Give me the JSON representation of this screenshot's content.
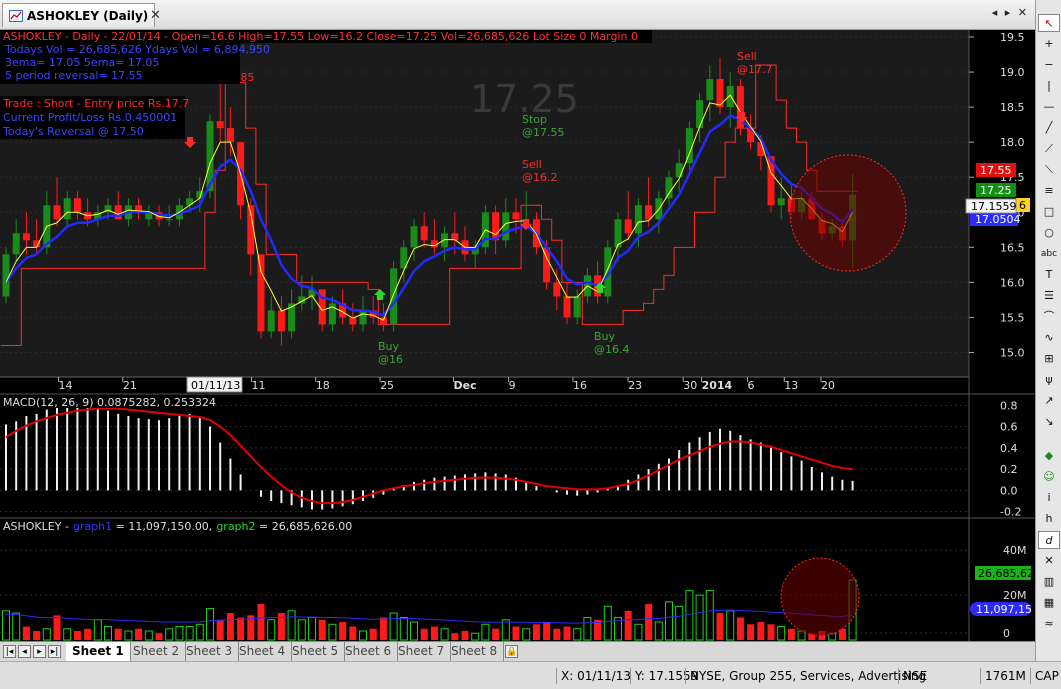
{
  "window": {
    "tab_title": "ASHOKLEY (Daily)"
  },
  "price_pane": {
    "header_line": "ASHOKLEY - Daily - 22/01/14 - Open=16.6  High=17.55  Low=16.2  Close=17.25  Vol=26,685,626   Lot Size 0  Margin  0",
    "info_lines": [
      "Todays Vol = 26,685,626 Ydays Vol = 6,894,950",
      "3ema= 17.05    5ema= 17.05",
      "5 period reversal=  17.55"
    ],
    "trade_lines": [
      "Trade : Short - Entry price Rs.17.7",
      "Current Profit/Loss Rs.0.450001",
      "Today's Reversal @ 17.50"
    ],
    "watermark": "17.25",
    "y_ticks": [
      "19.5",
      "19.0",
      "18.5",
      "18.0",
      "17.5",
      "17.0",
      "16.5",
      "16.0",
      "15.5",
      "15.0"
    ],
    "x_ticks": [
      "14",
      "21",
      "28",
      "11",
      "18",
      "25",
      "Dec",
      "9",
      "16",
      "23",
      "30",
      "2014",
      "6",
      "13",
      "20"
    ],
    "date_box": "01/11/13",
    "markers": [
      {
        "type": "sell",
        "label": "Sell",
        "price": "@18.85"
      },
      {
        "type": "buy",
        "label": "Buy",
        "price": "@16"
      },
      {
        "type": "stop",
        "label": "Stop",
        "price": "@17.55"
      },
      {
        "type": "sell",
        "label": "Sell",
        "price": "@16.2"
      },
      {
        "type": "buy",
        "label": "Buy",
        "price": "@16.4"
      },
      {
        "type": "sell",
        "label": "Sell",
        "price": "@17.7"
      }
    ],
    "axis_tags": {
      "high": "17.55",
      "close": "17.25",
      "cursor": "17.1559",
      "ema": "17.0504",
      "partial": "6"
    },
    "colors": {
      "up": "#1a8c1a",
      "down": "#ff1a1a",
      "ema_yellow": "#ffff33",
      "ema_blue": "#1f2bff",
      "stop_line": "#ff2a2a"
    }
  },
  "macd_pane": {
    "header": "MACD(12, 26, 9) 0.0875282, 0.253324",
    "y_ticks": [
      "0.8",
      "0.6",
      "0.4",
      "0.2",
      "0.0",
      "-0.2"
    ]
  },
  "volume_pane": {
    "symbol": "ASHOKLEY -",
    "graph1_label": "graph1",
    "graph1_value": " = 11,097,150.00,",
    "graph2_label": "graph2",
    "graph2_value": " = 26,685,626.00",
    "y_ticks": [
      "40M",
      "20M",
      "0"
    ],
    "tags": {
      "vol": "26,685,62",
      "avg": "11,097,15"
    }
  },
  "chart_data": [
    {
      "type": "candlestick",
      "title": "ASHOKLEY - Daily",
      "x_labels": [
        "14",
        "21",
        "28",
        "11",
        "18",
        "25",
        "Dec",
        "9",
        "16",
        "23",
        "30",
        "2014",
        "6",
        "13",
        "20"
      ],
      "ylim": [
        14.65,
        19.6
      ],
      "candles": [
        [
          15.8,
          16.5,
          15.7,
          16.4
        ],
        [
          16.4,
          16.9,
          16.3,
          16.7
        ],
        [
          16.7,
          17.0,
          16.4,
          16.6
        ],
        [
          16.6,
          16.9,
          16.4,
          16.5
        ],
        [
          16.5,
          17.3,
          16.4,
          17.1
        ],
        [
          17.1,
          17.5,
          16.8,
          16.9
        ],
        [
          16.9,
          17.3,
          16.8,
          17.2
        ],
        [
          17.2,
          17.3,
          16.9,
          17.0
        ],
        [
          17.0,
          17.2,
          16.8,
          16.9
        ],
        [
          16.9,
          17.1,
          16.8,
          17.0
        ],
        [
          17.0,
          17.2,
          16.9,
          17.1
        ],
        [
          17.1,
          17.3,
          16.9,
          16.9
        ],
        [
          16.9,
          17.2,
          16.8,
          17.1
        ],
        [
          17.1,
          17.2,
          16.9,
          17.0
        ],
        [
          16.9,
          17.1,
          16.8,
          17.0
        ],
        [
          17.0,
          17.1,
          16.8,
          16.9
        ],
        [
          16.9,
          17.1,
          16.8,
          16.9
        ],
        [
          16.9,
          17.2,
          16.8,
          17.1
        ],
        [
          17.1,
          17.3,
          17.0,
          17.2
        ],
        [
          17.2,
          17.5,
          17.0,
          17.3
        ],
        [
          17.3,
          18.4,
          17.2,
          18.3
        ],
        [
          18.3,
          18.9,
          18.0,
          18.2
        ],
        [
          18.2,
          18.5,
          17.8,
          18.0
        ],
        [
          18.0,
          18.0,
          16.9,
          17.1
        ],
        [
          17.1,
          17.2,
          16.1,
          16.4
        ],
        [
          16.4,
          16.4,
          15.2,
          15.3
        ],
        [
          15.3,
          15.8,
          15.2,
          15.6
        ],
        [
          15.6,
          15.8,
          15.1,
          15.3
        ],
        [
          15.3,
          15.9,
          15.2,
          15.7
        ],
        [
          15.7,
          16.1,
          15.6,
          15.8
        ],
        [
          15.8,
          16.1,
          15.6,
          15.9
        ],
        [
          15.9,
          15.9,
          15.3,
          15.4
        ],
        [
          15.4,
          15.8,
          15.3,
          15.7
        ],
        [
          15.7,
          15.9,
          15.4,
          15.5
        ],
        [
          15.5,
          15.7,
          15.3,
          15.4
        ],
        [
          15.4,
          15.8,
          15.3,
          15.6
        ],
        [
          15.6,
          15.8,
          15.4,
          15.5
        ],
        [
          15.5,
          15.7,
          15.3,
          15.4
        ],
        [
          15.4,
          16.3,
          15.3,
          16.2
        ],
        [
          16.2,
          16.6,
          16.0,
          16.5
        ],
        [
          16.5,
          16.9,
          16.3,
          16.8
        ],
        [
          16.8,
          17.0,
          16.5,
          16.6
        ],
        [
          16.6,
          16.9,
          16.4,
          16.5
        ],
        [
          16.5,
          16.8,
          16.3,
          16.7
        ],
        [
          16.7,
          17.0,
          16.4,
          16.6
        ],
        [
          16.6,
          16.8,
          16.3,
          16.4
        ],
        [
          16.4,
          16.6,
          16.2,
          16.5
        ],
        [
          16.5,
          17.1,
          16.4,
          17.0
        ],
        [
          17.0,
          17.1,
          16.4,
          16.6
        ],
        [
          16.6,
          17.2,
          16.5,
          17.0
        ],
        [
          17.0,
          17.2,
          16.7,
          16.9
        ],
        [
          16.9,
          17.3,
          16.8,
          16.9
        ],
        [
          16.9,
          17.0,
          16.4,
          16.5
        ],
        [
          16.5,
          16.6,
          15.9,
          16.0
        ],
        [
          16.0,
          16.2,
          15.6,
          15.8
        ],
        [
          15.8,
          16.0,
          15.4,
          15.5
        ],
        [
          15.5,
          15.9,
          15.4,
          15.8
        ],
        [
          15.8,
          16.2,
          15.7,
          16.1
        ],
        [
          16.1,
          16.3,
          15.7,
          15.8
        ],
        [
          15.8,
          16.6,
          15.7,
          16.5
        ],
        [
          16.5,
          17.0,
          16.3,
          16.9
        ],
        [
          16.9,
          17.3,
          16.6,
          16.7
        ],
        [
          16.7,
          17.2,
          16.5,
          17.1
        ],
        [
          17.1,
          17.5,
          16.8,
          16.9
        ],
        [
          16.9,
          17.3,
          16.7,
          17.2
        ],
        [
          17.2,
          17.6,
          17.1,
          17.5
        ],
        [
          17.5,
          17.9,
          17.3,
          17.7
        ],
        [
          17.7,
          18.3,
          17.6,
          18.2
        ],
        [
          18.2,
          18.7,
          18.0,
          18.6
        ],
        [
          18.6,
          19.1,
          18.3,
          18.9
        ],
        [
          18.9,
          19.2,
          18.4,
          18.5
        ],
        [
          18.5,
          19.0,
          18.2,
          18.8
        ],
        [
          18.8,
          18.9,
          18.1,
          18.2
        ],
        [
          18.2,
          18.4,
          17.9,
          18.0
        ],
        [
          18.0,
          18.1,
          17.6,
          17.8
        ],
        [
          17.8,
          17.8,
          17.0,
          17.1
        ],
        [
          17.1,
          17.5,
          16.9,
          17.2
        ],
        [
          17.2,
          17.4,
          16.9,
          17.0
        ],
        [
          17.0,
          17.3,
          16.9,
          17.2
        ],
        [
          17.2,
          17.3,
          16.9,
          16.9
        ],
        [
          16.9,
          17.0,
          16.6,
          16.7
        ],
        [
          16.7,
          16.9,
          16.6,
          16.8
        ],
        [
          16.8,
          16.9,
          16.5,
          16.6
        ],
        [
          16.6,
          17.55,
          16.2,
          17.25
        ]
      ],
      "ema_yellow": [
        16.0,
        16.3,
        16.5,
        16.5,
        16.8,
        16.85,
        17.0,
        17.0,
        16.95,
        16.97,
        17.03,
        16.97,
        17.03,
        17.02,
        17.01,
        16.94,
        16.92,
        17.0,
        17.1,
        17.2,
        17.7,
        18.0,
        18.0,
        17.55,
        16.98,
        16.15,
        15.88,
        15.59,
        15.65,
        15.73,
        15.81,
        15.6,
        15.65,
        15.58,
        15.49,
        15.55,
        15.53,
        15.46,
        15.83,
        16.17,
        16.48,
        16.54,
        16.52,
        16.61,
        16.61,
        16.5,
        16.5,
        16.75,
        16.68,
        16.84,
        16.87,
        16.88,
        16.69,
        16.35,
        16.07,
        15.79,
        15.79,
        15.95,
        15.87,
        16.19,
        16.54,
        16.62,
        16.86,
        16.88,
        17.04,
        17.27,
        17.48,
        17.84,
        18.22,
        18.56,
        18.53,
        18.67,
        18.43,
        18.22,
        18.01,
        17.56,
        17.38,
        17.19,
        17.2,
        17.05,
        16.88,
        16.84,
        16.72,
        17.0
      ],
      "ema_blue": [
        16.0,
        16.2,
        16.35,
        16.4,
        16.55,
        16.65,
        16.8,
        16.85,
        16.85,
        16.9,
        16.95,
        16.95,
        17.0,
        17.0,
        17.0,
        16.97,
        16.95,
        16.98,
        17.03,
        17.1,
        17.4,
        17.65,
        17.75,
        17.6,
        17.3,
        16.9,
        16.6,
        16.25,
        16.05,
        15.95,
        15.92,
        15.78,
        15.75,
        15.68,
        15.6,
        15.6,
        15.58,
        15.53,
        15.7,
        15.92,
        16.16,
        16.3,
        16.37,
        16.45,
        16.5,
        16.47,
        16.47,
        16.62,
        16.62,
        16.72,
        16.77,
        16.8,
        16.7,
        16.5,
        16.3,
        16.05,
        15.97,
        16.0,
        15.95,
        16.1,
        16.35,
        16.45,
        16.65,
        16.72,
        16.85,
        17.05,
        17.25,
        17.55,
        17.85,
        18.15,
        18.25,
        18.38,
        18.32,
        18.2,
        18.05,
        17.75,
        17.55,
        17.4,
        17.35,
        17.2,
        17.05,
        16.98,
        16.85,
        17.05
      ],
      "stop_line": [
        15.1,
        15.1,
        16.2,
        16.2,
        16.2,
        16.2,
        16.2,
        16.2,
        16.2,
        16.2,
        16.2,
        16.2,
        16.2,
        16.2,
        16.2,
        16.2,
        16.2,
        16.2,
        16.2,
        16.2,
        17.0,
        17.6,
        18.85,
        18.85,
        18.2,
        17.4,
        16.4,
        16.4,
        16.4,
        16.0,
        16.0,
        16.0,
        16.0,
        16.0,
        16.0,
        16.0,
        15.9,
        15.4,
        15.4,
        15.4,
        15.4,
        15.4,
        15.4,
        15.4,
        16.2,
        16.2,
        16.2,
        16.2,
        16.2,
        16.2,
        16.2,
        17.1,
        17.1,
        16.9,
        16.6,
        16.0,
        16.0,
        15.4,
        15.4,
        15.4,
        15.4,
        15.6,
        15.6,
        15.7,
        15.9,
        16.1,
        16.5,
        16.5,
        17.0,
        17.0,
        17.5,
        18.0,
        18.2,
        18.2,
        19.1,
        19.1,
        18.6,
        18.2,
        18.0,
        17.6,
        17.3,
        17.3,
        17.3,
        17.3
      ]
    },
    {
      "type": "bar",
      "title": "MACD(12, 26, 9)",
      "ylim": [
        -0.25,
        0.85
      ],
      "histogram": [
        0.62,
        0.65,
        0.7,
        0.72,
        0.76,
        0.8,
        0.82,
        0.84,
        0.8,
        0.78,
        0.75,
        0.72,
        0.7,
        0.68,
        0.67,
        0.66,
        0.68,
        0.7,
        0.72,
        0.68,
        0.6,
        0.45,
        0.3,
        0.15,
        0.0,
        -0.06,
        -0.1,
        -0.12,
        -0.14,
        -0.16,
        -0.18,
        -0.18,
        -0.17,
        -0.15,
        -0.13,
        -0.1,
        -0.07,
        -0.04,
        0.02,
        0.05,
        0.08,
        0.1,
        0.12,
        0.13,
        0.14,
        0.15,
        0.16,
        0.17,
        0.16,
        0.15,
        0.12,
        0.08,
        0.04,
        0.0,
        -0.02,
        -0.04,
        -0.05,
        -0.04,
        -0.02,
        0.02,
        0.05,
        0.1,
        0.15,
        0.2,
        0.25,
        0.3,
        0.38,
        0.45,
        0.5,
        0.55,
        0.58,
        0.56,
        0.52,
        0.48,
        0.45,
        0.42,
        0.36,
        0.32,
        0.28,
        0.22,
        0.17,
        0.13,
        0.1,
        0.09
      ],
      "signal": [
        0.5,
        0.56,
        0.61,
        0.65,
        0.68,
        0.71,
        0.73,
        0.75,
        0.76,
        0.77,
        0.77,
        0.77,
        0.76,
        0.75,
        0.74,
        0.73,
        0.72,
        0.71,
        0.7,
        0.69,
        0.66,
        0.6,
        0.52,
        0.42,
        0.32,
        0.22,
        0.13,
        0.05,
        -0.02,
        -0.07,
        -0.1,
        -0.12,
        -0.12,
        -0.11,
        -0.09,
        -0.06,
        -0.03,
        0.0,
        0.02,
        0.04,
        0.05,
        0.07,
        0.08,
        0.09,
        0.1,
        0.11,
        0.12,
        0.12,
        0.12,
        0.11,
        0.1,
        0.08,
        0.06,
        0.04,
        0.03,
        0.02,
        0.01,
        0.01,
        0.01,
        0.02,
        0.04,
        0.06,
        0.1,
        0.14,
        0.19,
        0.24,
        0.29,
        0.33,
        0.37,
        0.41,
        0.44,
        0.46,
        0.46,
        0.45,
        0.43,
        0.41,
        0.38,
        0.35,
        0.32,
        0.29,
        0.26,
        0.23,
        0.21,
        0.2
      ]
    },
    {
      "type": "bar",
      "title": "Volume",
      "ylim": [
        0,
        49
      ],
      "y_unit": "M",
      "volume": [
        13,
        12,
        6,
        4,
        5,
        11,
        5,
        4,
        5,
        9,
        6,
        5,
        4,
        5,
        4,
        3,
        5,
        6,
        6,
        7,
        14,
        9,
        12,
        10,
        11,
        16,
        9,
        12,
        13,
        9,
        10,
        9,
        7,
        8,
        6,
        4,
        5,
        10,
        12,
        10,
        8,
        5,
        6,
        5,
        3,
        4,
        3,
        7,
        5,
        9,
        6,
        5,
        7,
        8,
        5,
        6,
        5,
        10,
        9,
        15,
        10,
        13,
        7,
        16,
        8,
        17,
        15,
        22,
        20,
        22,
        12,
        13,
        10,
        7,
        8,
        7,
        6,
        5,
        4,
        3,
        4,
        3,
        5,
        26.7
      ],
      "average": [
        11.5,
        11.3,
        10.8,
        10.2,
        9.9,
        10.0,
        9.7,
        9.4,
        9.1,
        9.2,
        9.0,
        8.8,
        8.6,
        8.5,
        8.3,
        8.1,
        8.0,
        8.0,
        8.0,
        8.1,
        8.6,
        8.8,
        9.0,
        9.2,
        9.4,
        9.8,
        9.9,
        10.1,
        10.3,
        10.2,
        10.2,
        10.1,
        10.0,
        9.9,
        9.7,
        9.4,
        9.2,
        9.3,
        9.5,
        9.6,
        9.5,
        9.3,
        9.1,
        8.9,
        8.6,
        8.4,
        8.1,
        8.0,
        7.9,
        8.0,
        7.9,
        7.9,
        7.8,
        7.8,
        7.7,
        7.6,
        7.5,
        7.7,
        7.8,
        8.3,
        8.6,
        9.1,
        9.0,
        9.5,
        9.6,
        10.2,
        10.6,
        11.5,
        12.2,
        13.0,
        13.2,
        13.3,
        13.1,
        12.9,
        12.7,
        12.4,
        12.2,
        11.9,
        11.6,
        11.2,
        10.9,
        10.6,
        10.5,
        11.1
      ]
    }
  ],
  "sheets": {
    "tabs": [
      "Sheet 1",
      "Sheet 2",
      "Sheet 3",
      "Sheet 4",
      "Sheet 5",
      "Sheet 6",
      "Sheet 7",
      "Sheet 8"
    ],
    "active": "Sheet 1"
  },
  "statusbar": {
    "x_readout": "X: 01/11/13",
    "y_readout": "Y: 17.1559",
    "exchange_info": "NYSE, Group 255, Services, Advertising",
    "market": "NSE",
    "memory": "1761M",
    "caps": "CAP"
  },
  "toolbar": {
    "icons": [
      "cursor-icon",
      "zoom-in-icon",
      "zoom-out-icon",
      "vertical-line-icon",
      "horizontal-line-icon",
      "trend-line-icon",
      "ray-icon",
      "extended-line-icon",
      "channel-icon",
      "rectangle-icon",
      "ellipse-icon",
      "text-icon",
      "text-box-icon",
      "fibonacci-icon",
      "arc-icon",
      "cycles-icon",
      "gann-icon",
      "andrews-pitchfork-icon",
      "arrow-up-icon",
      "arrow-down-icon",
      "magnet-icon",
      "smiley-icon",
      "italic-i-icon",
      "h-icon",
      "d-icon",
      "close-icon",
      "ladder-icon",
      "grid-icon",
      "wave-icon"
    ]
  }
}
